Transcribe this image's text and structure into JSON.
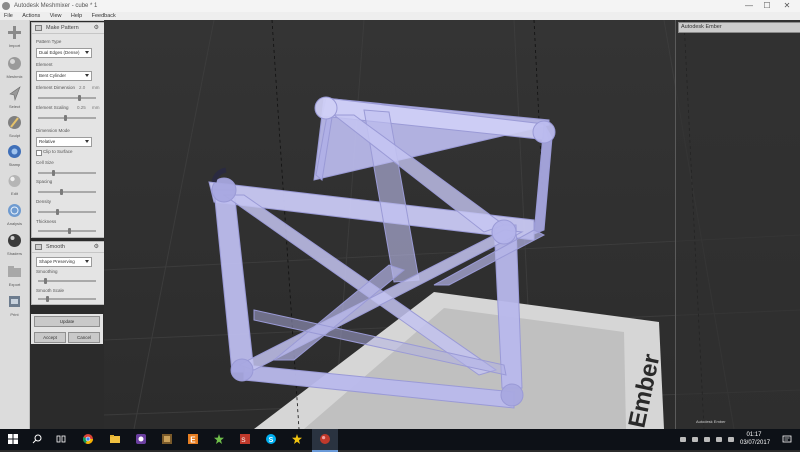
{
  "window": {
    "title": "Autodesk Meshmixer - cube * 1",
    "minimize": "—",
    "maximize": "☐",
    "close": "✕"
  },
  "menu": [
    "File",
    "Actions",
    "View",
    "Help",
    "Feedback"
  ],
  "tools": [
    {
      "label": "Import",
      "icon": "plus-icon"
    },
    {
      "label": "Meshmix",
      "icon": "sphere-icon"
    },
    {
      "label": "Select",
      "icon": "cursor-icon"
    },
    {
      "label": "Sculpt",
      "icon": "brush-icon"
    },
    {
      "label": "Stamp",
      "icon": "stamp-icon"
    },
    {
      "label": "Edit",
      "icon": "edit-sphere-icon"
    },
    {
      "label": "Analysis",
      "icon": "analysis-icon"
    },
    {
      "label": "Shaders",
      "icon": "shader-ball-icon"
    },
    {
      "label": "Export",
      "icon": "export-folder-icon"
    },
    {
      "label": "Print",
      "icon": "printer-icon"
    }
  ],
  "make_pattern": {
    "title": "Make Pattern",
    "pattern_type_label": "Pattern Type",
    "pattern_type_value": "Dual Edges (Dense)",
    "element_label": "Element",
    "element_value": "Bent Cylinder",
    "element_dimension_label": "Element Dimension",
    "element_dimension_value": "2.0",
    "element_dimension_unit": "mm",
    "element_scaling_label": "Element Scaling",
    "element_scaling_value": "0.25",
    "element_scaling_unit": "mm",
    "dimension_mode_label": "Dimension Mode",
    "dimension_mode_value": "Relative",
    "clip_checkbox_label": "Clip to Surface",
    "size_label": "Cell Size",
    "spacing_label": "Spacing",
    "density_label": "Density",
    "thickness_label": "Thickness"
  },
  "smoothing": {
    "title": "Smooth",
    "type_value": "Shape Preserving",
    "smoothing_label": "Smoothing",
    "smoothing_scale_label": "Smooth Scale"
  },
  "buttons": {
    "update": "Update",
    "accept": "Accept",
    "cancel": "Cancel"
  },
  "right_panel": {
    "title": "Autodesk Ember",
    "status": "Autodesk Ember"
  },
  "viewport": {
    "bed_brand": "Ember"
  },
  "taskbar": {
    "time": "01:17",
    "date": "03/07/2017"
  },
  "colors": {
    "mesh_fill": "#c4c4f0",
    "mesh_shadow": "#8a8ac8",
    "bed": "#d6d6d6",
    "taskbar": "#0d1117"
  }
}
